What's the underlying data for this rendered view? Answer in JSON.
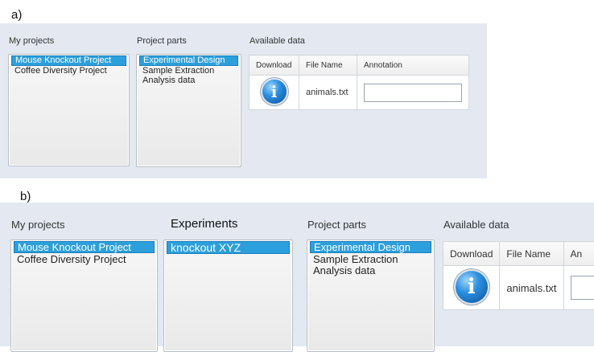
{
  "panel_a": {
    "figure_label": "a)",
    "my_projects": {
      "label": "My projects",
      "items": [
        {
          "label": "Mouse Knockout Project",
          "selected": true
        },
        {
          "label": "Coffee Diversity Project",
          "selected": false
        }
      ]
    },
    "project_parts": {
      "label": "Project parts",
      "items": [
        {
          "label": "Experimental Design",
          "selected": true
        },
        {
          "label": "Sample Extraction",
          "selected": false
        },
        {
          "label": "Analysis data",
          "selected": false
        }
      ]
    },
    "available_data": {
      "label": "Available data",
      "columns": [
        "Download",
        "File Name",
        "Annotation"
      ],
      "rows": [
        {
          "download_icon": "info-icon",
          "file_name": "animals.txt",
          "annotation": ""
        }
      ]
    }
  },
  "panel_b": {
    "figure_label": "b)",
    "my_projects": {
      "label": "My projects",
      "items": [
        {
          "label": "Mouse Knockout Project",
          "selected": true
        },
        {
          "label": "Coffee Diversity Project",
          "selected": false
        }
      ]
    },
    "experiments": {
      "label": "Experiments",
      "items": [
        {
          "label": "knockout XYZ",
          "selected": true
        }
      ]
    },
    "project_parts": {
      "label": "Project parts",
      "items": [
        {
          "label": "Experimental Design",
          "selected": true
        },
        {
          "label": "Sample Extraction",
          "selected": false
        },
        {
          "label": "Analysis data",
          "selected": false
        }
      ]
    },
    "available_data": {
      "label": "Available data",
      "columns": [
        "Download",
        "File Name",
        "An"
      ],
      "rows": [
        {
          "download_icon": "info-icon",
          "file_name": "animals.txt",
          "annotation": ""
        }
      ]
    }
  },
  "colors": {
    "panel_background": "#e4e9f1",
    "selection": "#2c9fdc",
    "info_icon": "#2b8fe0"
  }
}
